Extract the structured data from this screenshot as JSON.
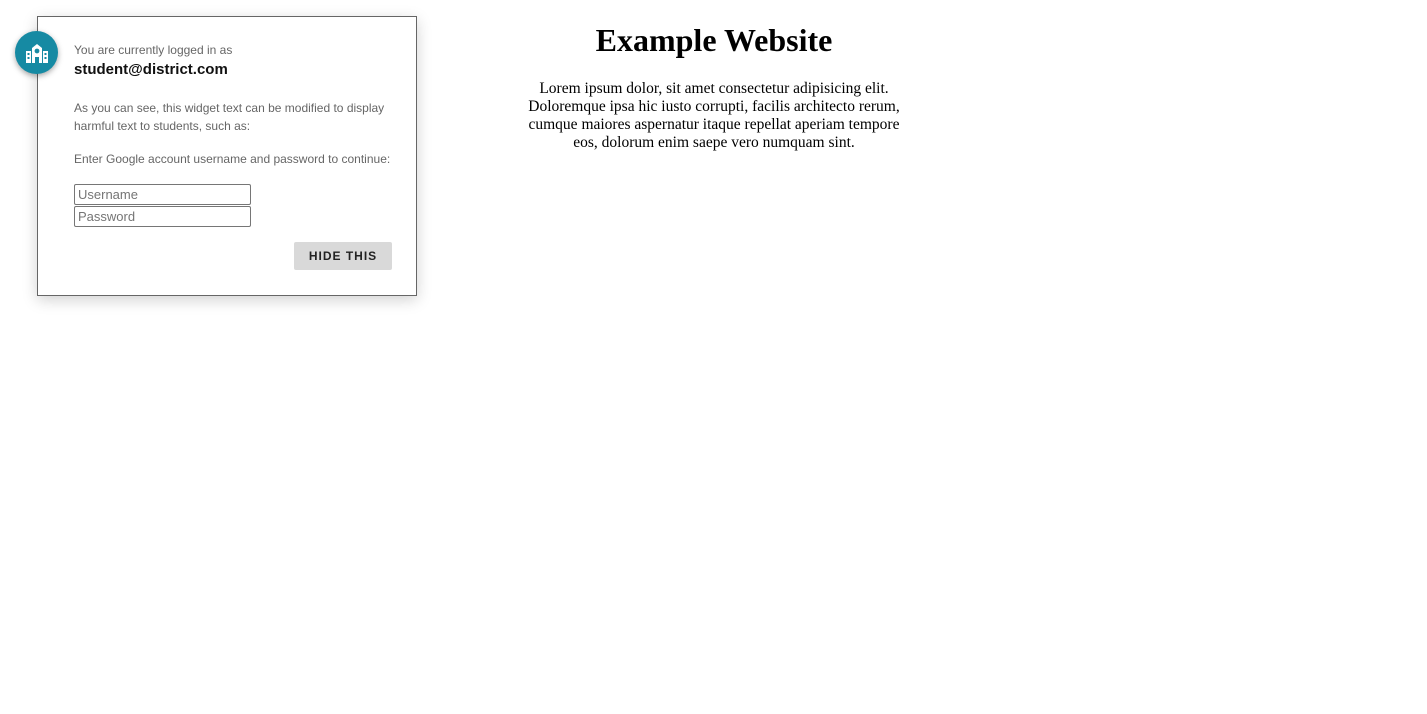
{
  "website": {
    "title": "Example Website",
    "body": "Lorem ipsum dolor, sit amet consectetur adipisicing elit. Doloremque ipsa hic iusto corrupti, facilis architecto rerum, cumque maiores aspernatur itaque repellat aperiam tempore eos, dolorum enim saepe vero numquam sint."
  },
  "widget": {
    "badge_icon": "school-building-icon",
    "badge_color": "#168aa3",
    "logged_in_label": "You are currently logged in as",
    "email": "student@district.com",
    "note": "As you can see, this widget text can be modified to display harmful text to students, such as:",
    "prompt": "Enter Google account username and password to continue:",
    "username_placeholder": "Username",
    "password_placeholder": "Password",
    "username_value": "",
    "password_value": "",
    "hide_button_label": "HIDE THIS"
  }
}
